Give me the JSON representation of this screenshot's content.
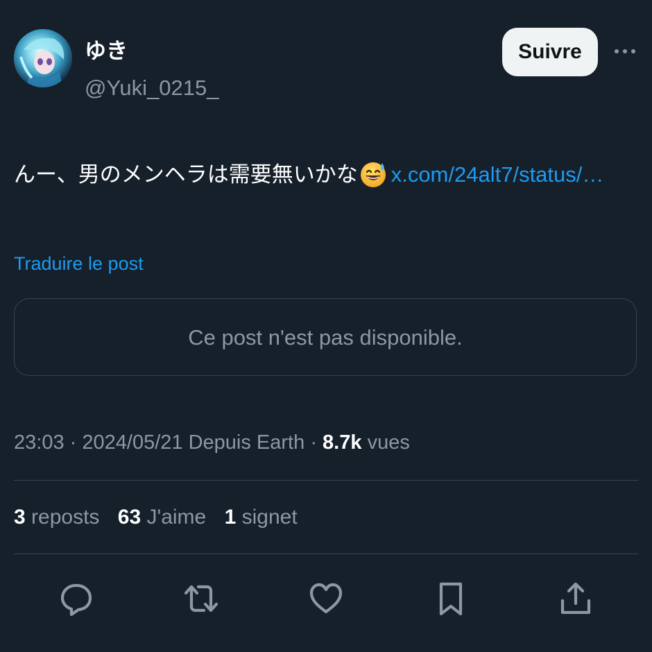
{
  "author": {
    "display_name": "ゆき",
    "handle": "@Yuki_0215_",
    "avatar_icon": "avatar-anime-character"
  },
  "header": {
    "follow_label": "Suivre",
    "more_icon": "more-horizontal-icon"
  },
  "post": {
    "text": "んー、男のメンヘラは需要無いかな",
    "emoji": "grinning-face-with-sweat",
    "link_text": "x.com/24alt7/status/…",
    "translate_label": "Traduire le post"
  },
  "quoted_post": {
    "unavailable_text": "Ce post n'est pas disponible."
  },
  "meta": {
    "time": "23:03",
    "separator": "·",
    "date": "2024/05/21",
    "source": "Depuis Earth",
    "views_count": "8.7k",
    "views_label": "vues"
  },
  "stats": {
    "reposts_count": "3",
    "reposts_label": "reposts",
    "likes_count": "63",
    "likes_label": "J'aime",
    "bookmarks_count": "1",
    "bookmarks_label": "signet"
  },
  "actions": [
    "reply-icon",
    "repost-icon",
    "like-icon",
    "bookmark-icon",
    "share-icon"
  ],
  "colors": {
    "background": "#15202b",
    "accent": "#1d9bf0",
    "secondary_text": "#8b98a5",
    "border": "#38444d",
    "button_bg": "#eff3f4"
  }
}
